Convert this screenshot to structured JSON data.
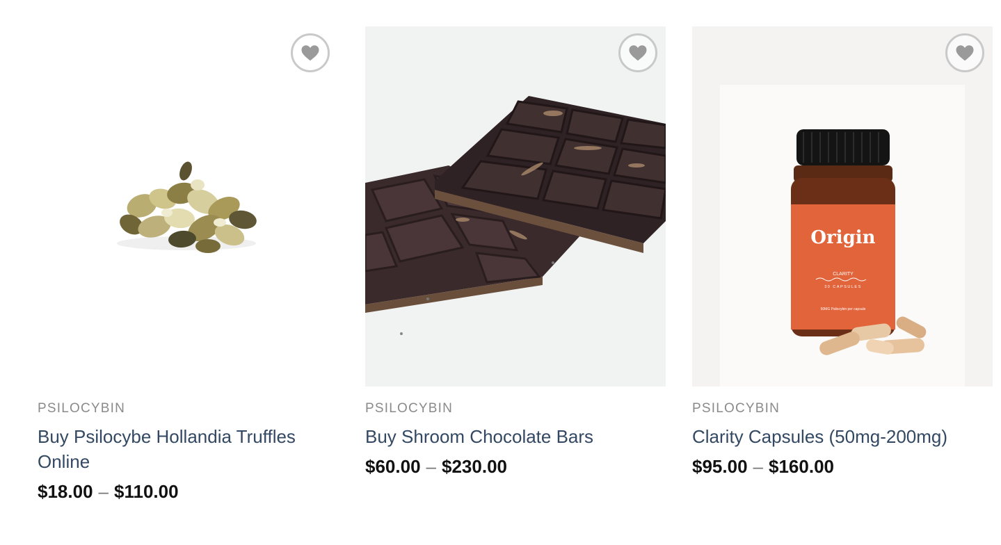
{
  "products": [
    {
      "category": "PSILOCYBIN",
      "title": "Buy Psilocybe Hollandia Truffles Online",
      "price_min": "$18.00",
      "price_sep": "–",
      "price_max": "$110.00",
      "image": "truffles"
    },
    {
      "category": "PSILOCYBIN",
      "title": "Buy Shroom Chocolate Bars",
      "price_min": "$60.00",
      "price_sep": "–",
      "price_max": "$230.00",
      "image": "chocolate-bars"
    },
    {
      "category": "PSILOCYBIN",
      "title": "Clarity Capsules (50mg-200mg)",
      "price_min": "$95.00",
      "price_sep": "–",
      "price_max": "$160.00",
      "image": "capsule-bottle",
      "label": {
        "brand": "Origin",
        "product": "CLARITY",
        "count": "30 CAPSULES",
        "dose": "50MG Psilocybin per capsule"
      }
    }
  ],
  "icons": {
    "wishlist": "heart-icon"
  },
  "colors": {
    "title": "#334862",
    "category": "#8a8a8a",
    "price": "#111111",
    "wishlist_ring": "#c9c9c9",
    "bottle_label": "#e2643a"
  }
}
